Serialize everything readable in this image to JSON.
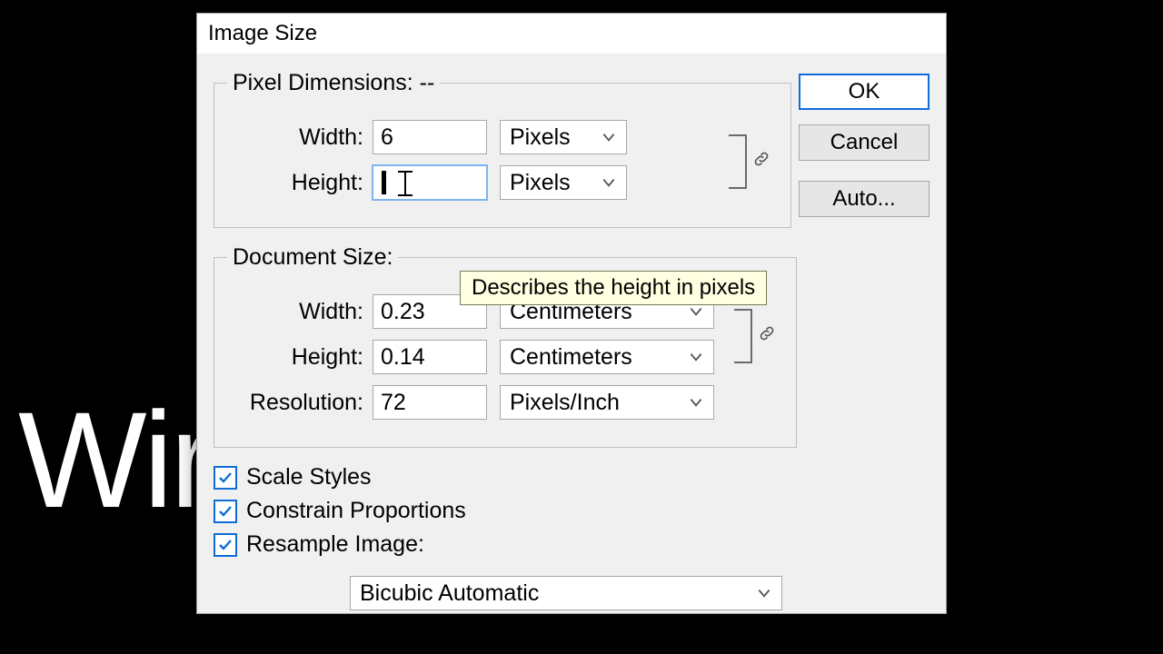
{
  "background_text": "Wir",
  "dialog": {
    "title": "Image Size",
    "pixel_dimensions": {
      "legend": "Pixel Dimensions:  --",
      "width_label": "Width:",
      "width_value": "6",
      "width_unit": "Pixels",
      "height_label": "Height:",
      "height_value": "",
      "height_unit": "Pixels"
    },
    "document_size": {
      "legend": "Document Size:",
      "width_label": "Width:",
      "width_value": "0.23",
      "width_unit": "Centimeters",
      "height_label": "Height:",
      "height_value": "0.14",
      "height_unit": "Centimeters",
      "resolution_label": "Resolution:",
      "resolution_value": "72",
      "resolution_unit": "Pixels/Inch"
    },
    "checks": {
      "scale_styles": "Scale Styles",
      "constrain": "Constrain Proportions",
      "resample": "Resample Image:"
    },
    "resample_method": "Bicubic Automatic",
    "buttons": {
      "ok": "OK",
      "cancel": "Cancel",
      "auto": "Auto..."
    },
    "tooltip": "Describes the height in pixels"
  }
}
